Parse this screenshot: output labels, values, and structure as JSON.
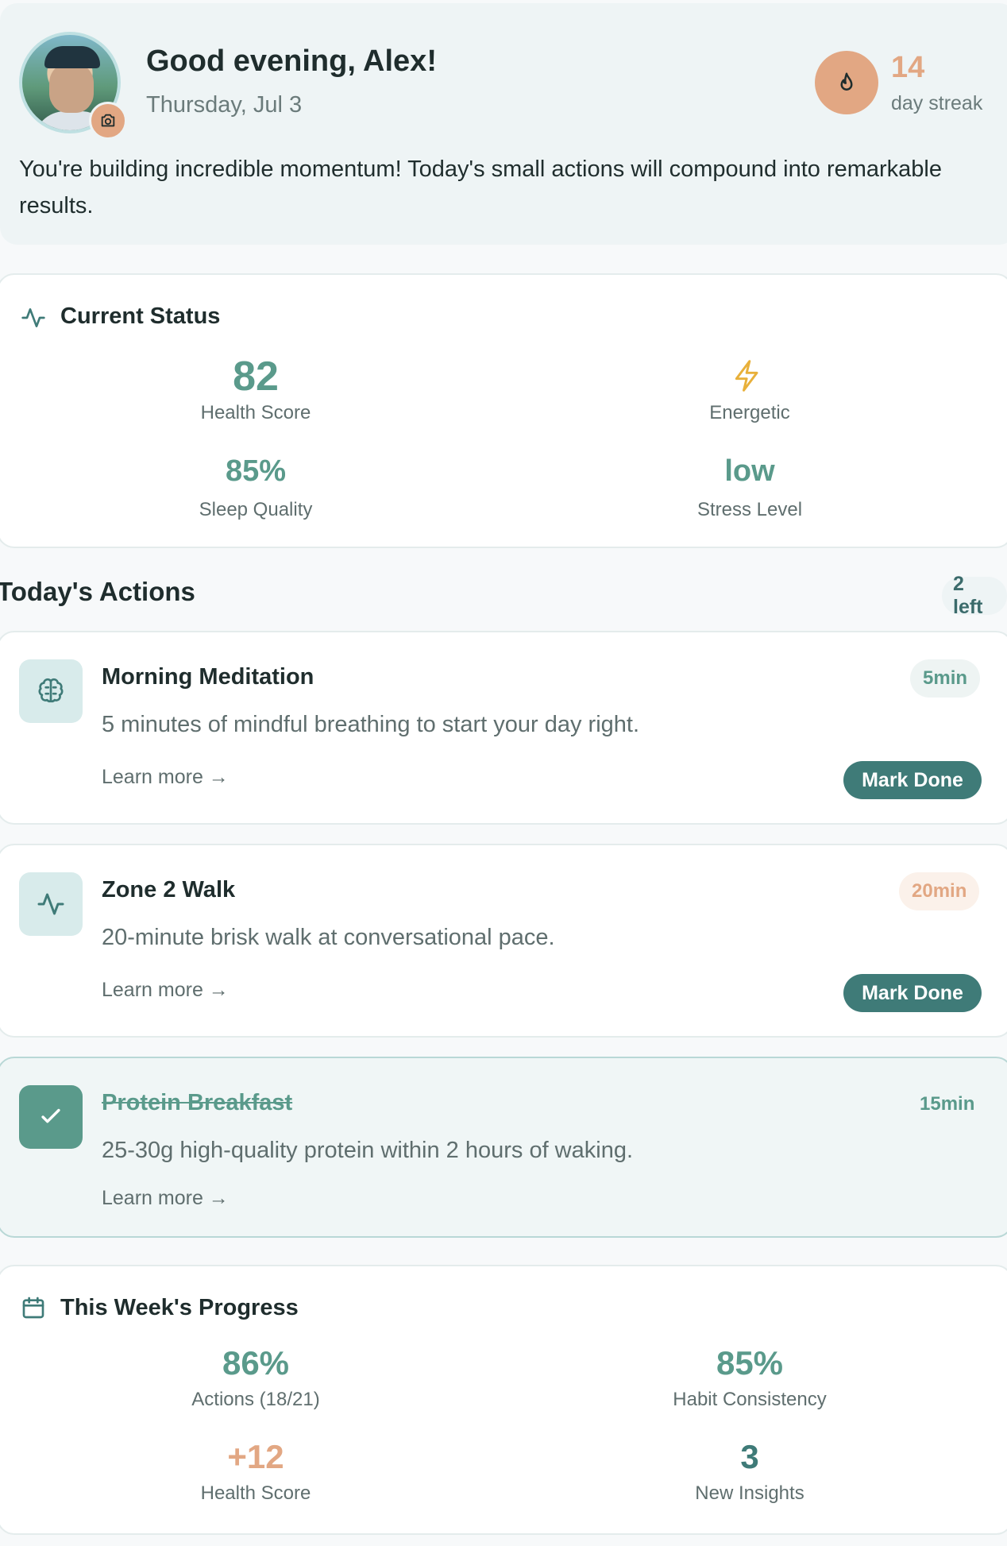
{
  "header": {
    "greeting": "Good evening, Alex!",
    "date": "Thursday, Jul 3",
    "streak_count": "14",
    "streak_label": "day streak",
    "motivation": "You're building incredible momentum! Today's small actions will compound into remarkable results."
  },
  "current_status": {
    "title": "Current Status",
    "health_score_value": "82",
    "health_score_label": "Health Score",
    "energy_label": "Energetic",
    "sleep_value": "85%",
    "sleep_label": "Sleep Quality",
    "stress_value": "low",
    "stress_label": "Stress Level"
  },
  "actions": {
    "heading": "Today's Actions",
    "remaining": "2 left",
    "learn_more": "Learn more →",
    "mark_done": "Mark Done",
    "items": [
      {
        "title": "Morning Meditation",
        "description": "5 minutes of mindful breathing to start your day right.",
        "duration": "5min",
        "completed": false,
        "icon": "brain-icon"
      },
      {
        "title": "Zone 2 Walk",
        "description": "20-minute brisk walk at conversational pace.",
        "duration": "20min",
        "completed": false,
        "icon": "activity-icon"
      },
      {
        "title": "Protein Breakfast",
        "description": "25-30g high-quality protein within 2 hours of waking.",
        "duration": "15min",
        "completed": true,
        "icon": "check-icon"
      }
    ]
  },
  "weekly_progress": {
    "title": "This Week's Progress",
    "actions_value": "86%",
    "actions_label": "Actions (18/21)",
    "habit_value": "85%",
    "habit_label": "Habit Consistency",
    "health_delta_value": "+12",
    "health_delta_label": "Health Score",
    "insights_value": "3",
    "insights_label": "New Insights"
  },
  "colors": {
    "accent_teal": "#5a9a8b",
    "button_teal": "#3f7b78",
    "accent_orange": "#e2a783",
    "background": "#f7f9fa"
  }
}
